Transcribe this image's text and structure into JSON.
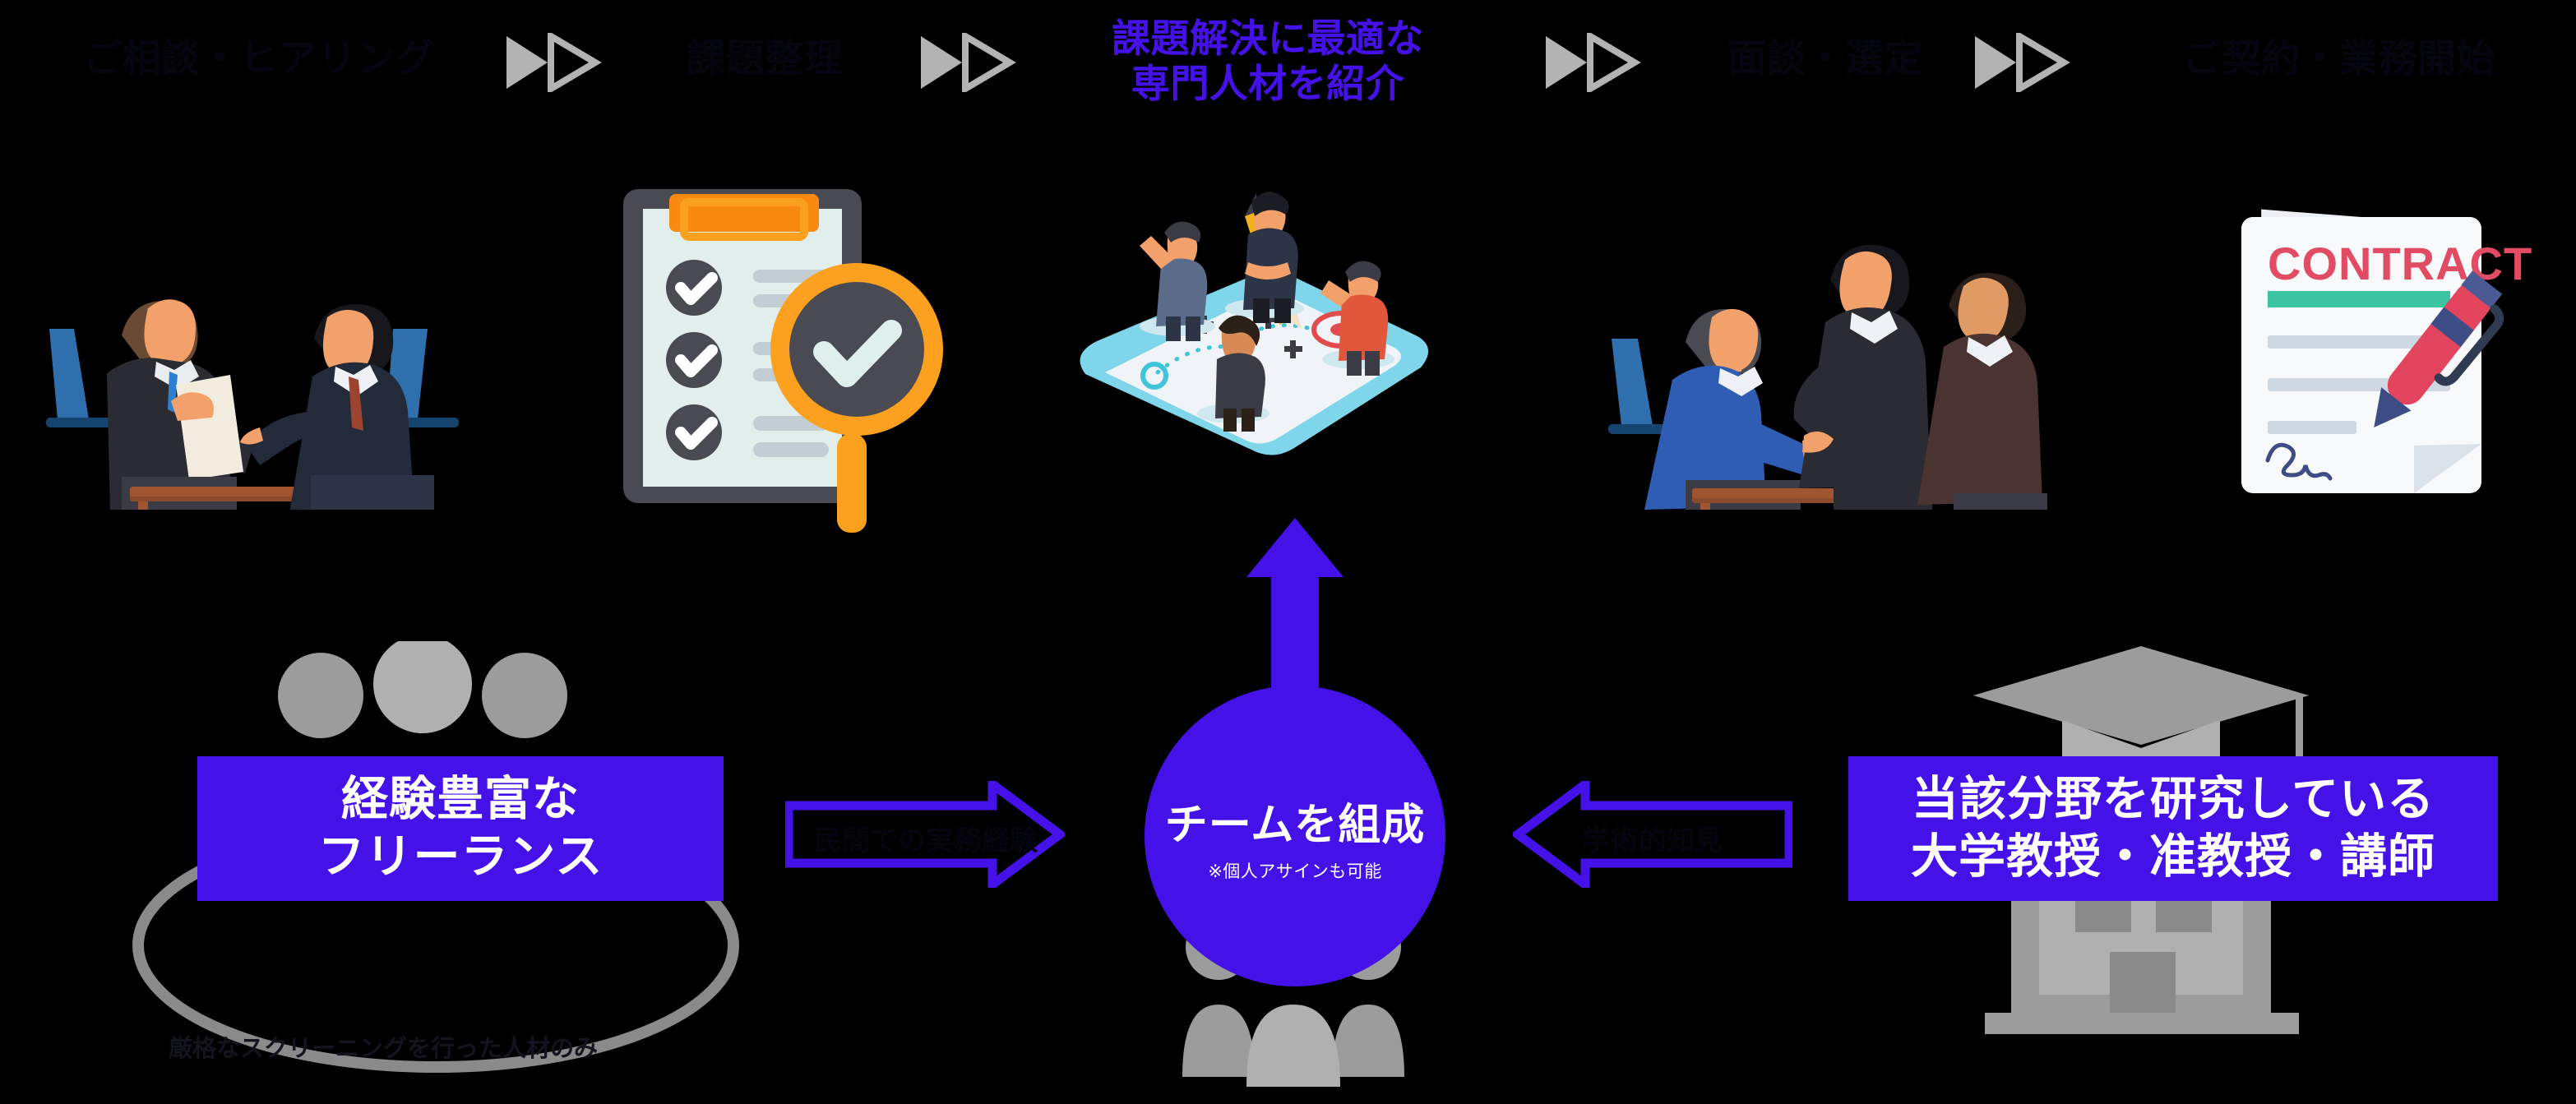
{
  "theme": {
    "background": "#000000",
    "accent_purple": "#4412e8",
    "chevron_gray": "#b3b3b3",
    "dark_text": "#050510",
    "white": "#ffffff"
  },
  "flow": {
    "steps": [
      {
        "id": "step-1",
        "label": "ご相談・ヒアリング",
        "lines": [
          "ご相談・ヒアリング"
        ],
        "accent": false,
        "illustration": "meeting-interview-illustration"
      },
      {
        "id": "step-2",
        "label": "課題整理",
        "lines": [
          "課題整理"
        ],
        "accent": false,
        "illustration": "checklist-magnifier-illustration"
      },
      {
        "id": "step-3",
        "label": "課題解決に最適な専門人材を紹介",
        "lines": [
          "課題解決に最適な",
          "専門人材を紹介"
        ],
        "accent": true,
        "illustration": "team-matching-board-illustration"
      },
      {
        "id": "step-4",
        "label": "面談・選定",
        "lines": [
          "面談・選定"
        ],
        "accent": false,
        "illustration": "handshake-meeting-illustration"
      },
      {
        "id": "step-5",
        "label": "ご契約・業務開始",
        "lines": [
          "ご契約・業務開始"
        ],
        "accent": false,
        "illustration": "contract-signing-illustration"
      }
    ],
    "separators": [
      {
        "id": "chevron-1",
        "icon": "double-chevron-right-icon"
      },
      {
        "id": "chevron-2",
        "icon": "double-chevron-right-icon"
      },
      {
        "id": "chevron-3",
        "icon": "double-chevron-right-icon"
      },
      {
        "id": "chevron-4",
        "icon": "double-chevron-right-icon"
      }
    ]
  },
  "bottom": {
    "left_card": {
      "id": "freelance-card",
      "lines": [
        "経験豊富な",
        "フリーランス"
      ],
      "icon": "people-group-icon",
      "caption": "厳格なスクリーニングを行った人材のみ"
    },
    "right_card": {
      "id": "professor-card",
      "lines": [
        "当該分野を研究している",
        "大学教授・准教授・講師"
      ],
      "icon": "graduation-building-icon"
    },
    "center": {
      "id": "team-circle",
      "title": "チームを組成",
      "note": "※個人アサインも可能",
      "icon": "people-group-icon"
    },
    "arrows": [
      {
        "id": "arrow-left-to-center",
        "label": "民間での実務経験",
        "direction": "right",
        "icon": "block-arrow-right-icon"
      },
      {
        "id": "arrow-right-to-center",
        "label": "学術的知見",
        "direction": "left",
        "icon": "block-arrow-left-icon"
      }
    ],
    "up_arrow": {
      "id": "arrow-center-to-step3",
      "icon": "arrow-up-icon"
    }
  },
  "contract_illustration": {
    "title": "CONTRACT",
    "title_color": "#e14b63",
    "accent_bar_color": "#3cc3a0"
  }
}
